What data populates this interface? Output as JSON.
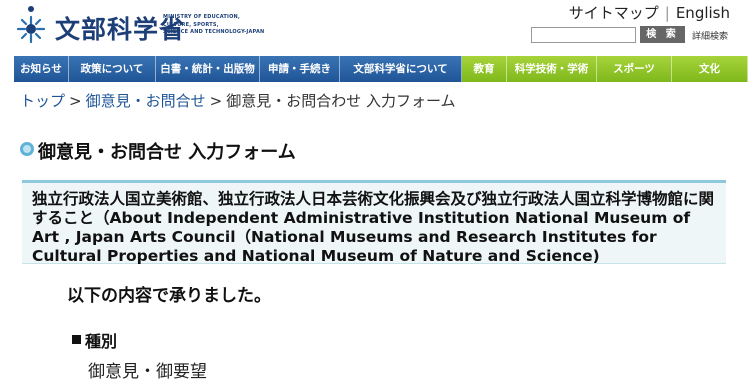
{
  "header": {
    "logo_text": "文部科学省",
    "logo_en": "MINISTRY OF EDUCATION,\nCULTURE, SPORTS,\nSCIENCE AND TECHNOLOGY-JAPAN",
    "sitemap_label": "サイトマップ",
    "separator": "|",
    "english_label": "English",
    "search_button_label": "検 索",
    "advanced_search_label": "詳細検索"
  },
  "nav": {
    "items": [
      {
        "label": "お知らせ"
      },
      {
        "label": "政策について"
      },
      {
        "label": "白書・統計・出版物"
      },
      {
        "label": "申請・手続き"
      },
      {
        "label": "文部科学省について"
      },
      {
        "label": "教育"
      },
      {
        "label": "科学技術・学術"
      },
      {
        "label": "スポーツ"
      },
      {
        "label": "文化"
      }
    ],
    "colors": {
      "blue": "#2a64a6",
      "green": "#8cc42a"
    }
  },
  "breadcrumb": {
    "items": [
      "トップ",
      "御意見・お問合せ",
      "御意見・お問合わせ 入力フォーム"
    ],
    "separator": ">"
  },
  "page": {
    "title": "御意見・お問合せ 入力フォーム",
    "category": "独立行政法人国立美術館、独立行政法人日本芸術文化振興会及び独立行政法人国立科学博物館に関すること（About Independent Administrative Institution National Museum of Art , Japan Arts Council（National Museums and Research Institutes for Cultural Properties and National Museum of Nature and Science)",
    "received_message": "以下の内容で承りました。",
    "field_label": "種別",
    "field_value": "御意見・御要望"
  }
}
